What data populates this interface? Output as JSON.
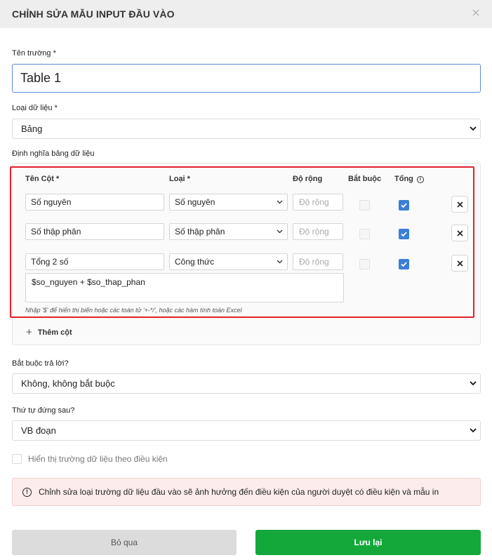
{
  "modal": {
    "title": "CHỈNH SỬA MẪU INPUT ĐẦU VÀO",
    "close_icon": "close-icon"
  },
  "field_name": {
    "label": "Tên trường *",
    "value": "Table 1"
  },
  "data_type": {
    "label": "Loại dữ liệu *",
    "value": "Bảng"
  },
  "table_def": {
    "label": "Định nghĩa bảng dữ liệu",
    "headers": {
      "name": "Tên Cột *",
      "type": "Loại *",
      "width": "Độ rộng",
      "required": "Bắt buộc",
      "total": "Tổng"
    },
    "rows": [
      {
        "name": "Số nguyên",
        "type": "Số nguyên",
        "width_placeholder": "Độ rộng",
        "required": false,
        "total": true
      },
      {
        "name": "Số thập phân",
        "type": "Số thập phân",
        "width_placeholder": "Độ rộng",
        "required": false,
        "total": true
      },
      {
        "name": "Tổng 2 số",
        "type": "Công thức",
        "width_placeholder": "Độ rộng",
        "required": false,
        "total": true,
        "formula": "$so_nguyen + $so_thap_phan"
      }
    ],
    "formula_hint": "Nhập '$' để hiển thị biến hoặc các toán tử '+-*/', hoặc các hàm tính toán Excel",
    "add_column": "Thêm cột"
  },
  "required_answer": {
    "label": "Bắt buộc trả lời?",
    "value": "Không, không bắt buộc"
  },
  "order_after": {
    "label": "Thứ tự đứng sau?",
    "value": "VB đoạn"
  },
  "conditional": {
    "label": "Hiển thị trường dữ liệu theo điều kiện",
    "checked": false
  },
  "warning": {
    "text": "Chỉnh sửa loại trường dữ liệu đầu vào sẽ ảnh hưởng đến điều kiện của người duyệt có điều kiện và mẫu in"
  },
  "buttons": {
    "cancel": "Bỏ qua",
    "save": "Lưu lại"
  },
  "colors": {
    "save": "#14a83b",
    "highlight": "#e3202e",
    "checkbox": "#3a7fd9",
    "warning_bg": "#fdecec"
  }
}
